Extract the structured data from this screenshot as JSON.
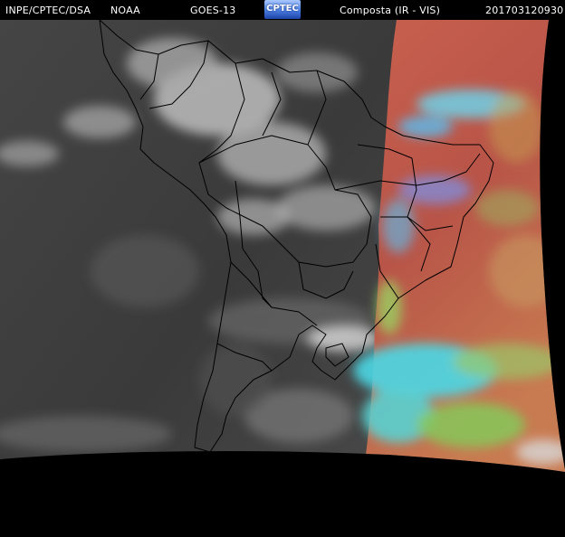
{
  "header": {
    "org": "INPE/CPTEC/DSA",
    "agency": "NOAA",
    "satellite": "GOES-13",
    "logo_text": "CPTEC",
    "product": "Composta (IR - VIS)",
    "timestamp": "201703120930"
  },
  "colors": {
    "background": "#000000",
    "ir_dark": "#3a3a3a",
    "ir_light": "#7a7a7a",
    "cloud": "#dcdcdc",
    "vis_red": "#c05a4e",
    "vis_cyan": "#4ad8e6",
    "vis_green": "#86c85a",
    "border": "#000000"
  }
}
